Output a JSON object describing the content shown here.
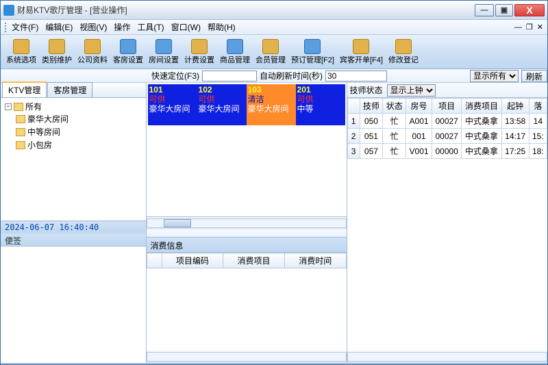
{
  "title": "财易KTV歌厅管理 - [营业操作]",
  "menu": [
    "文件(F)",
    "编辑(E)",
    "视图(V)",
    "操作",
    "工具(T)",
    "窗口(W)",
    "帮助(H)"
  ],
  "toolbar": [
    {
      "label": "系统选项"
    },
    {
      "label": "类别维护"
    },
    {
      "label": "公司资料"
    },
    {
      "label": "客房设置",
      "blue": true
    },
    {
      "label": "房间设置",
      "blue": true
    },
    {
      "label": "计费设置"
    },
    {
      "label": "商品管理",
      "blue": true
    },
    {
      "label": "会员管理"
    },
    {
      "label": "预订管理[F2]",
      "blue": true
    },
    {
      "label": "宾客开单[F4]"
    },
    {
      "label": "修改登记"
    }
  ],
  "quick": {
    "locate_label": "快速定位(F3)",
    "auto_label": "自动刷新时间(秒)",
    "interval": "30",
    "show_all": "显示所有",
    "refresh": "刷新"
  },
  "tabs": {
    "ktv": "KTV管理",
    "room": "客房管理"
  },
  "tree": {
    "root": "所有",
    "items": [
      "豪华大房间",
      "中等房间",
      "小包房"
    ]
  },
  "timestamp": "2024-06-07 16:40:40",
  "note_label": "便签",
  "rooms": [
    {
      "num": "101",
      "status": "可供",
      "type": "豪华大房间",
      "cls": "avail"
    },
    {
      "num": "102",
      "status": "可供",
      "type": "豪华大房间",
      "cls": "avail"
    },
    {
      "num": "103",
      "status": "清洁",
      "type": "豪华大房间",
      "cls": "clean"
    },
    {
      "num": "201",
      "status": "可供",
      "type": "中等",
      "cls": "avail"
    }
  ],
  "cons": {
    "head": "消费信息",
    "cols": [
      "项目编码",
      "消费项目",
      "消费时间"
    ]
  },
  "right": {
    "tech_label": "技师状态",
    "show_on": "显示上钟",
    "cols": [
      "技师",
      "状态",
      "房号",
      "项目",
      "消费项目",
      "起钟",
      "落"
    ],
    "rows": [
      {
        "i": "1",
        "tech": "050",
        "st": "忙",
        "room": "A001",
        "proj": "00027",
        "cp": "中式桑拿",
        "start": "13:58",
        "end": "14"
      },
      {
        "i": "2",
        "tech": "051",
        "st": "忙",
        "room": "001",
        "proj": "00027",
        "cp": "中式桑拿",
        "start": "14:17",
        "end": "15:"
      },
      {
        "i": "3",
        "tech": "057",
        "st": "忙",
        "room": "V001",
        "proj": "00000",
        "cp": "中式桑拿",
        "start": "17:25",
        "end": "18:"
      }
    ]
  }
}
